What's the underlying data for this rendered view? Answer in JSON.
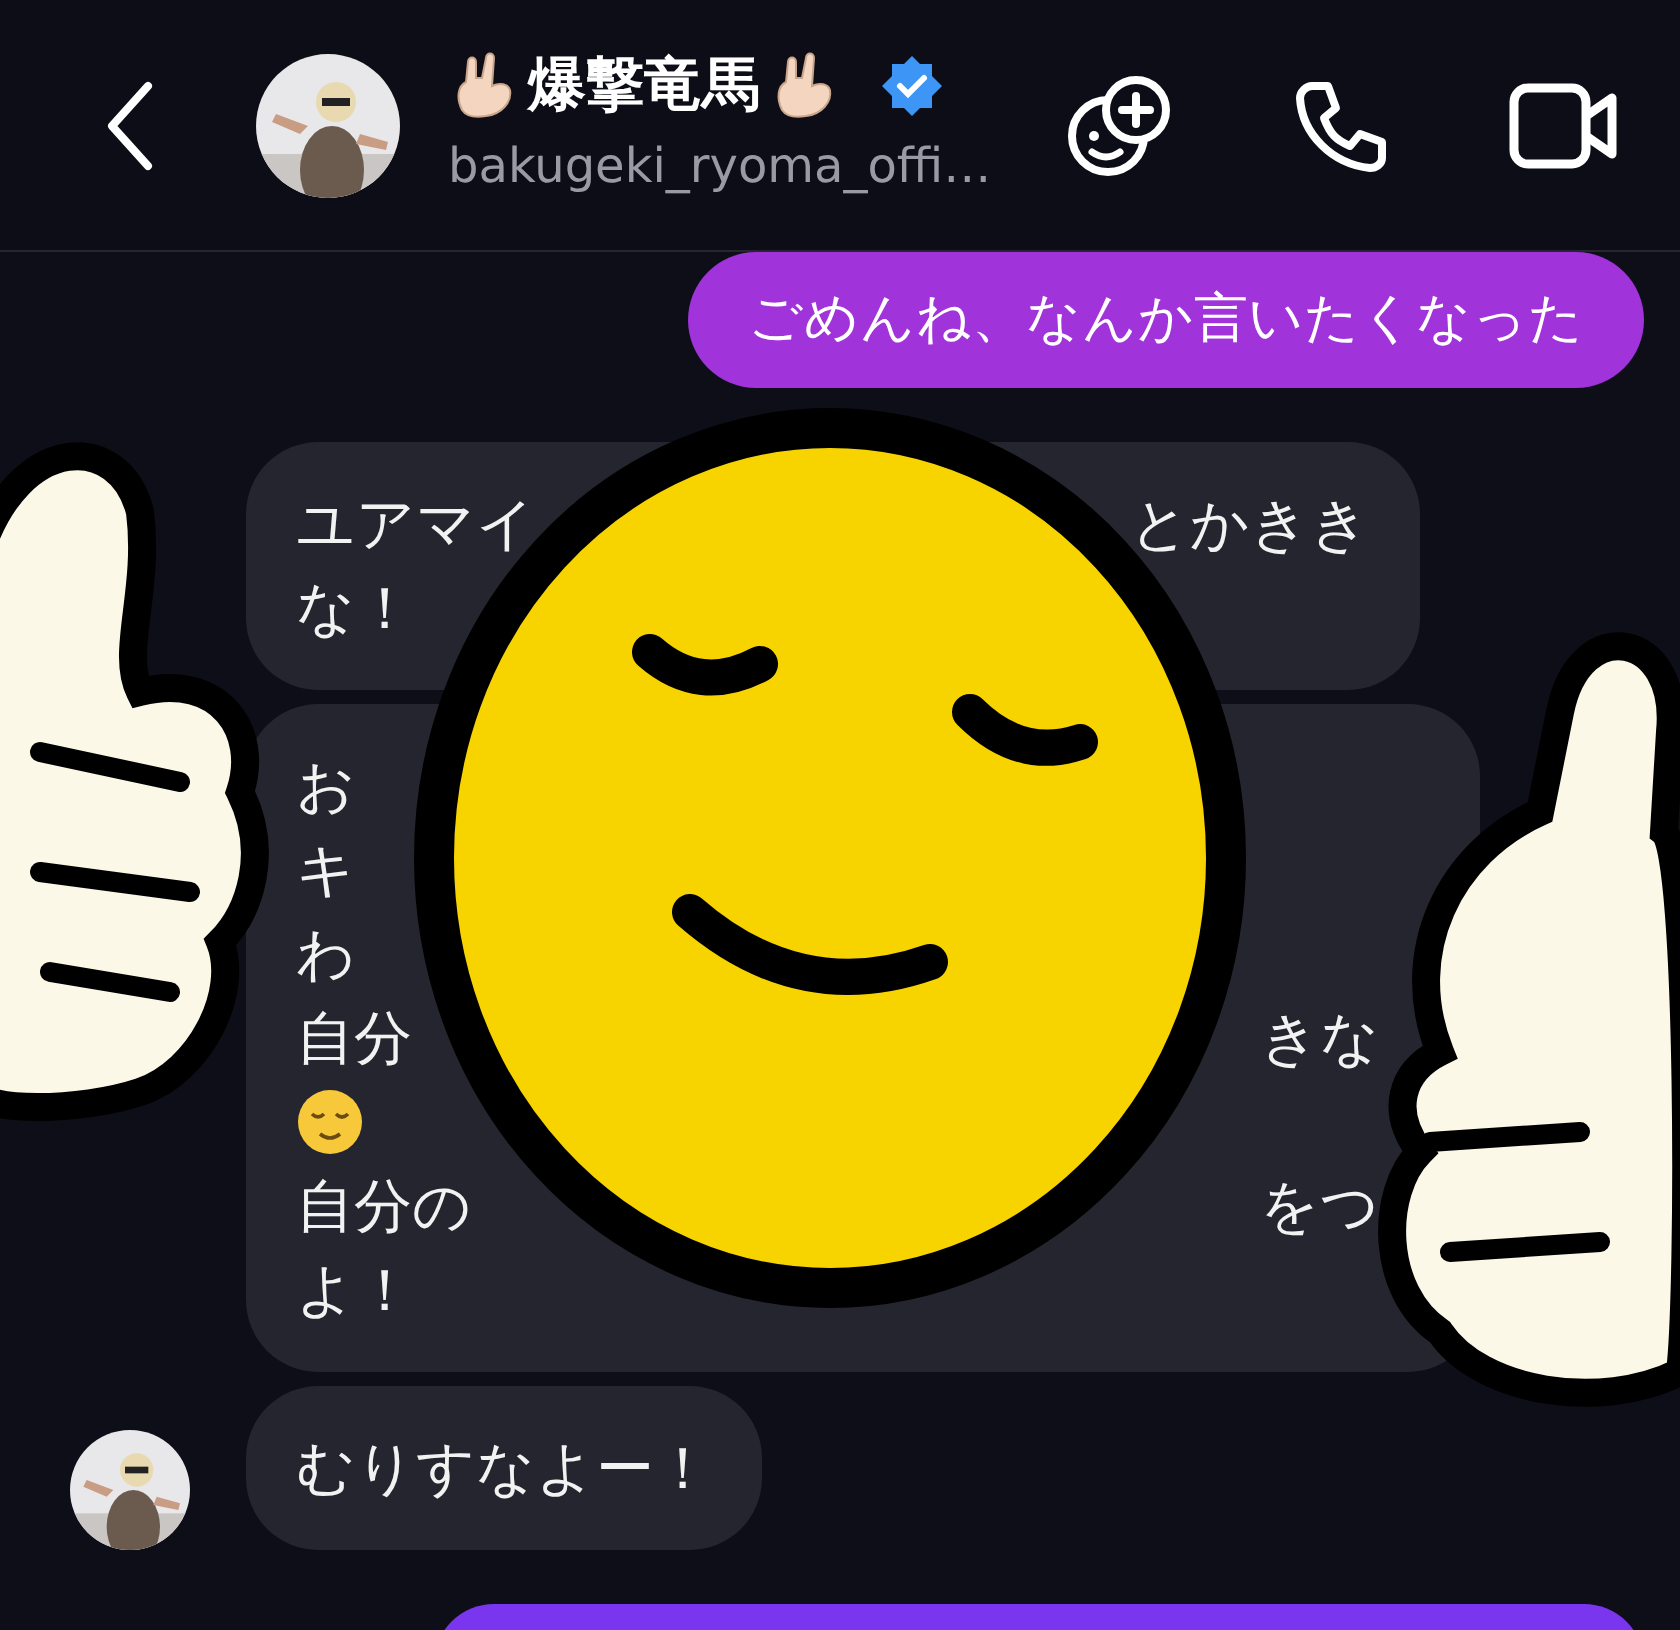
{
  "header": {
    "name": "爆撃竜馬",
    "verified": true,
    "username": "bakugeki_ryoma_offi…"
  },
  "messages": [
    {
      "kind": "sent",
      "lines": [
        {
          "left": "ごめんね、なんか言いたくなった"
        }
      ]
    },
    {
      "kind": "received",
      "avatar": false,
      "lines": [
        {
          "left": "ユアマイ",
          "right": "とかきき"
        },
        {
          "left": "な！"
        }
      ]
    },
    {
      "kind": "received",
      "avatar": false,
      "lines": [
        {
          "left": "お"
        },
        {
          "left": "キ"
        },
        {
          "left": "わ"
        },
        {
          "left": "自分",
          "right": "きな"
        },
        {
          "kind": "emoji"
        },
        {
          "left": "自分の",
          "right": "をつ"
        },
        {
          "left": "よ！"
        }
      ]
    },
    {
      "kind": "received",
      "avatar": true,
      "lines": [
        {
          "left": "むりすなよー！"
        }
      ]
    },
    {
      "kind": "sent"
    }
  ]
}
